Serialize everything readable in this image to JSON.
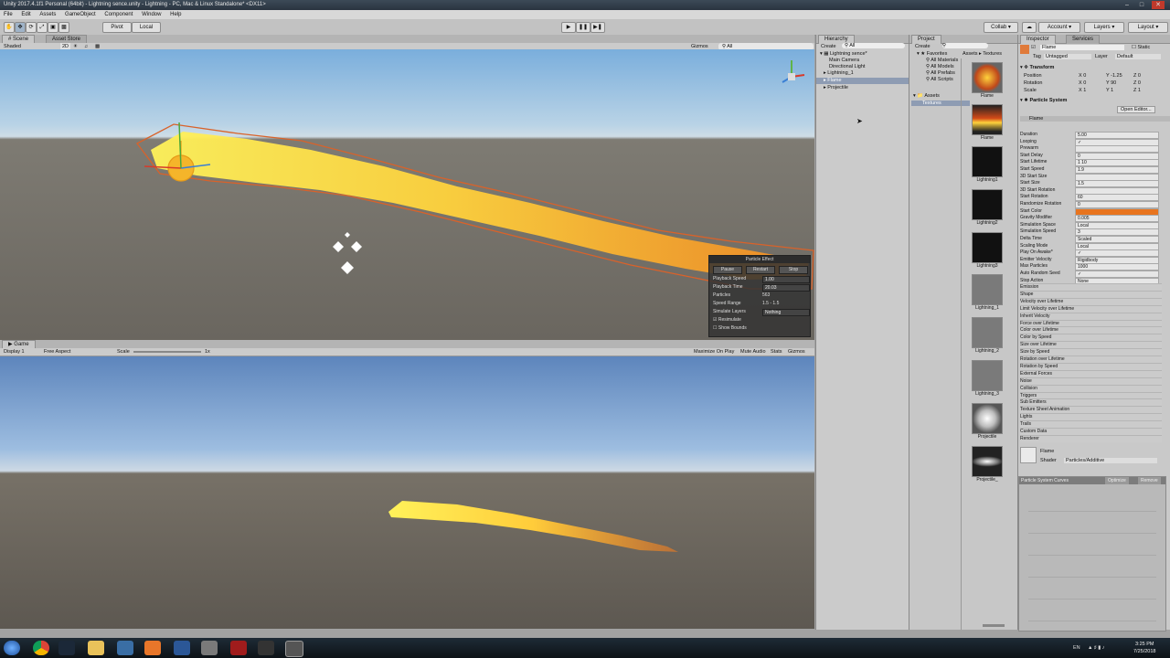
{
  "window": {
    "title": "Unity 2017.4.1f1 Personal (64bit) - Lightning sence.unity - Lightning - PC, Mac & Linux Standalone* <DX11>"
  },
  "menu": [
    "File",
    "Edit",
    "Assets",
    "GameObject",
    "Component",
    "Window",
    "Help"
  ],
  "toolbar": {
    "pivot": "Pivot",
    "local": "Local",
    "collab": "Collab",
    "account": "Account",
    "layers": "Layers",
    "layout": "Layout"
  },
  "scene": {
    "tab_scene": "Scene",
    "tab_asset_store": "Asset Store",
    "shading": "Shaded",
    "mode_2d": "2D",
    "gizmos": "Gizmos",
    "search": "All"
  },
  "particle_overlay": {
    "title": "Particle Effect",
    "pause": "Pause",
    "restart": "Restart",
    "stop": "Stop",
    "rows": [
      {
        "label": "Playback Speed",
        "value": "1.00"
      },
      {
        "label": "Playback Time",
        "value": "20.03"
      },
      {
        "label": "Particles",
        "value": "563"
      },
      {
        "label": "Speed Range",
        "value": "1.5 - 1.5"
      },
      {
        "label": "Simulate Layers",
        "value": "Nothing"
      }
    ],
    "resimulate": "Resimulate",
    "show_bounds": "Show Bounds"
  },
  "game": {
    "tab": "Game",
    "display": "Display 1",
    "aspect": "Free Aspect",
    "scale_label": "Scale",
    "scale_value": "1x",
    "maximize": "Maximize On Play",
    "mute": "Mute Audio",
    "stats": "Stats",
    "gizmos": "Gizmos"
  },
  "hierarchy": {
    "tab": "Hierarchy",
    "create": "Create",
    "search": "All",
    "scene_name": "Lightning sence*",
    "items": [
      "Main Camera",
      "Directional Light",
      "Lightning_1",
      "Flame",
      "Projectile"
    ]
  },
  "project": {
    "tab": "Project",
    "create": "Create",
    "favorites": "Favorites",
    "favorite_items": [
      "All Materials",
      "All Models",
      "All Prefabs",
      "All Scripts"
    ],
    "assets": "Assets",
    "asset_folders": [
      "Textures"
    ],
    "breadcrumb": "Assets ▸ Textures",
    "grid": [
      "Flame",
      "Flame",
      "Lightning1",
      "Lightning2",
      "Lightning3",
      "Lightning_1",
      "Lightning_2",
      "Lightning_3",
      "Projectile",
      "Projectile_"
    ]
  },
  "inspector": {
    "tab": "Inspector",
    "tab2": "Services",
    "name": "Flame",
    "static": "Static",
    "tag_label": "Tag",
    "tag": "Untagged",
    "layer_label": "Layer",
    "layer": "Default",
    "transform": "Transform",
    "position": {
      "label": "Position",
      "x": "0",
      "y": "-1.25",
      "z": "0"
    },
    "rotation": {
      "label": "Rotation",
      "x": "0",
      "y": "90",
      "z": "0"
    },
    "scale": {
      "label": "Scale",
      "x": "1",
      "y": "1",
      "z": "1"
    },
    "particle_system": "Particle System",
    "open_editor": "Open Editor...",
    "ps_name": "Flame",
    "props": [
      {
        "label": "Duration",
        "value": "5.00"
      },
      {
        "label": "Looping",
        "value": "✓"
      },
      {
        "label": "Prewarm",
        "value": ""
      },
      {
        "label": "Start Delay",
        "value": "0"
      },
      {
        "label": "Start Lifetime",
        "value": "1             10"
      },
      {
        "label": "Start Speed",
        "value": "1.9"
      },
      {
        "label": "3D Start Size",
        "value": ""
      },
      {
        "label": "Start Size",
        "value": "1.5"
      },
      {
        "label": "3D Start Rotation",
        "value": ""
      },
      {
        "label": "Start Rotation",
        "value": "60"
      },
      {
        "label": "Randomize Rotation",
        "value": "0"
      },
      {
        "label": "Start Color",
        "value": ""
      },
      {
        "label": "Gravity Modifier",
        "value": "0.005"
      },
      {
        "label": "Simulation Space",
        "value": "Local"
      },
      {
        "label": "Simulation Speed",
        "value": "3"
      },
      {
        "label": "Delta Time",
        "value": "Scaled"
      },
      {
        "label": "Scaling Mode",
        "value": "Local"
      },
      {
        "label": "Play On Awake*",
        "value": "✓"
      },
      {
        "label": "Emitter Velocity",
        "value": "Rigidbody"
      },
      {
        "label": "Max Particles",
        "value": "1000"
      },
      {
        "label": "Auto Random Seed",
        "value": "✓"
      },
      {
        "label": "Stop Action",
        "value": "None"
      }
    ],
    "modules": [
      "Emission",
      "Shape",
      "Velocity over Lifetime",
      "Limit Velocity over Lifetime",
      "Inherit Velocity",
      "Force over Lifetime",
      "Color over Lifetime",
      "Color by Speed",
      "Size over Lifetime",
      "Size by Speed",
      "Rotation over Lifetime",
      "Rotation by Speed",
      "External Forces",
      "Noise",
      "Collision",
      "Triggers",
      "Sub Emitters",
      "Texture Sheet Animation",
      "Lights",
      "Trails",
      "Custom Data",
      "Renderer"
    ],
    "material": "Flame",
    "shader_label": "Shader",
    "shader": "Particles/Additive",
    "curves_title": "Particle System Curves",
    "optimize": "Optimize",
    "remove": "Remove"
  },
  "taskbar": {
    "lang": "EN",
    "time": "3:25 PM",
    "date": "7/25/2018"
  },
  "colors": {
    "start_color": "#e8741e",
    "flame_core": "#ffe14a",
    "flame_edge": "#e2541a"
  }
}
